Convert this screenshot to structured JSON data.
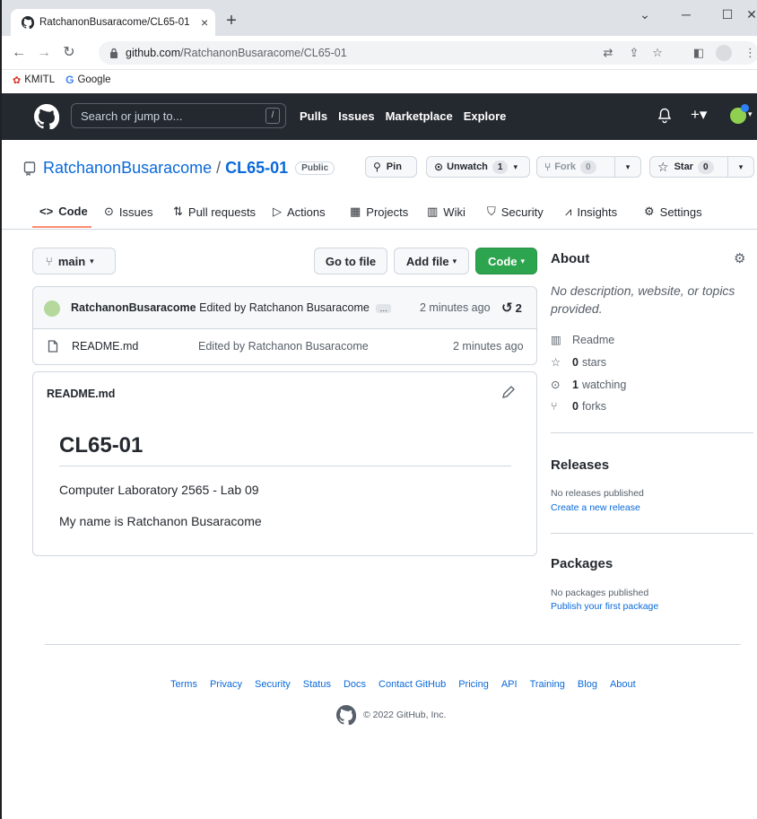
{
  "browser": {
    "tab_title": "RatchanonBusaracome/CL65-01",
    "tab_close": "×",
    "new_tab": "+",
    "url_host": "github.com",
    "url_path": "/RatchanonBusaracome/CL65-01",
    "bookmarks": [
      "KMITL",
      "Google"
    ]
  },
  "header": {
    "search_placeholder": "Search or jump to...",
    "search_key": "/",
    "nav": [
      "Pulls",
      "Issues",
      "Marketplace",
      "Explore"
    ]
  },
  "repo": {
    "owner": "RatchanonBusaracome",
    "separator": "/",
    "name": "CL65-01",
    "visibility": "Public",
    "pin_label": "Pin",
    "unwatch_label": "Unwatch",
    "unwatch_count": "1",
    "fork_label": "Fork",
    "fork_count": "0",
    "star_label": "Star",
    "star_count": "0"
  },
  "tabs": [
    "Code",
    "Issues",
    "Pull requests",
    "Actions",
    "Projects",
    "Wiki",
    "Security",
    "Insights",
    "Settings"
  ],
  "files": {
    "branch": "main",
    "go_to_file": "Go to file",
    "add_file": "Add file",
    "code": "Code",
    "commit_author": "RatchanonBusaracome",
    "commit_message": "Edited by Ratchanon Busaracome",
    "commit_ellipsis": "…",
    "commit_time": "2 minutes ago",
    "commit_count": "2",
    "rows": [
      {
        "name": "README.md",
        "message": "Edited by Ratchanon Busaracome",
        "time": "2 minutes ago"
      }
    ]
  },
  "readme": {
    "filename": "README.md",
    "heading": "CL65-01",
    "line1": "Computer Laboratory 2565 - Lab 09",
    "line2": "My name is Ratchanon Busaracome"
  },
  "about": {
    "title": "About",
    "description": "No description, website, or topics provided.",
    "readme": "Readme",
    "stars_count": "0",
    "stars_label": "stars",
    "watching_count": "1",
    "watching_label": "watching",
    "forks_count": "0",
    "forks_label": "forks"
  },
  "releases": {
    "title": "Releases",
    "empty": "No releases published",
    "link": "Create a new release"
  },
  "packages": {
    "title": "Packages",
    "empty": "No packages published",
    "link": "Publish your first package"
  },
  "footer": {
    "links": [
      "Terms",
      "Privacy",
      "Security",
      "Status",
      "Docs",
      "Contact GitHub",
      "Pricing",
      "API",
      "Training",
      "Blog",
      "About"
    ],
    "copyright": "© 2022 GitHub, Inc."
  },
  "colors": {
    "link": "#0969da",
    "header_bg": "#24292f",
    "green_button": "#2da44e",
    "tab_underline": "#fd8c73"
  }
}
